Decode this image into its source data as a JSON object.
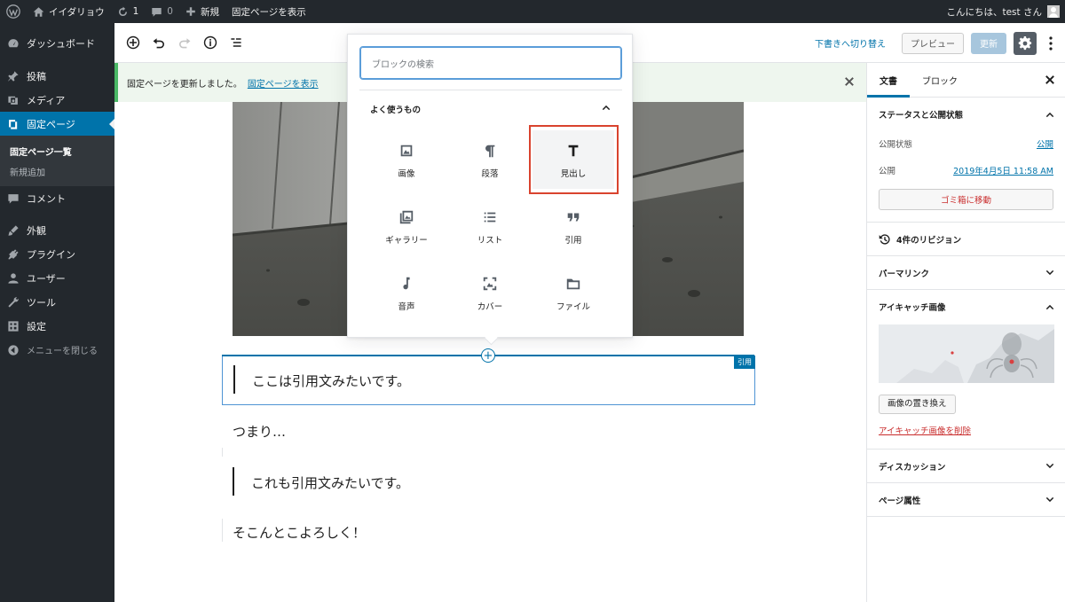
{
  "admin_bar": {
    "site_name": "イイダリョウ",
    "updates_count": "1",
    "comments_count": "0",
    "new_label": "新規",
    "view_page": "固定ページを表示",
    "greeting": "こんにちは、test さん"
  },
  "sidebar": {
    "items": [
      {
        "label": "ダッシュボード",
        "icon": "dashboard-icon"
      },
      {
        "label": "投稿",
        "icon": "pin-icon"
      },
      {
        "label": "メディア",
        "icon": "media-icon"
      },
      {
        "label": "固定ページ",
        "icon": "pages-icon"
      },
      {
        "label": "コメント",
        "icon": "comments-icon"
      },
      {
        "label": "外観",
        "icon": "appearance-icon"
      },
      {
        "label": "プラグイン",
        "icon": "plugins-icon"
      },
      {
        "label": "ユーザー",
        "icon": "users-icon"
      },
      {
        "label": "ツール",
        "icon": "tools-icon"
      },
      {
        "label": "設定",
        "icon": "settings-icon"
      }
    ],
    "submenu": [
      "固定ページ一覧",
      "新規追加"
    ],
    "collapse": "メニューを閉じる"
  },
  "header": {
    "switch_draft": "下書きへ切り替え",
    "preview": "プレビュー",
    "update": "更新"
  },
  "notice": {
    "text": "固定ページを更新しました。",
    "link": "固定ページを表示"
  },
  "inserter": {
    "search_placeholder": "ブロックの検索",
    "panel_title": "よく使うもの",
    "blocks": [
      {
        "label": "画像",
        "icon": "image-icon"
      },
      {
        "label": "段落",
        "icon": "paragraph-icon"
      },
      {
        "label": "見出し",
        "icon": "heading-icon"
      },
      {
        "label": "ギャラリー",
        "icon": "gallery-icon"
      },
      {
        "label": "リスト",
        "icon": "list-icon"
      },
      {
        "label": "引用",
        "icon": "quote-icon"
      },
      {
        "label": "音声",
        "icon": "audio-icon"
      },
      {
        "label": "カバー",
        "icon": "cover-icon"
      },
      {
        "label": "ファイル",
        "icon": "file-icon"
      }
    ]
  },
  "content": {
    "quote1": "ここは引用文みたいです。",
    "block_tag": "引用",
    "para1": "つまり…",
    "quote2": "これも引用文みたいです。",
    "para2": "そこんとこよろしく！"
  },
  "settings": {
    "tab_document": "文書",
    "tab_block": "ブロック",
    "status_title": "ステータスと公開状態",
    "visibility_label": "公開状態",
    "visibility_value": "公開",
    "publish_label": "公開",
    "publish_value": "2019年4月5日 11:58 AM",
    "trash": "ゴミ箱に移動",
    "revisions": "4件のリビジョン",
    "permalink": "パーマリンク",
    "featured_image": "アイキャッチ画像",
    "replace_image": "画像の置き換え",
    "remove_image": "アイキャッチ画像を削除",
    "discussion": "ディスカッション",
    "page_attributes": "ページ属性"
  }
}
